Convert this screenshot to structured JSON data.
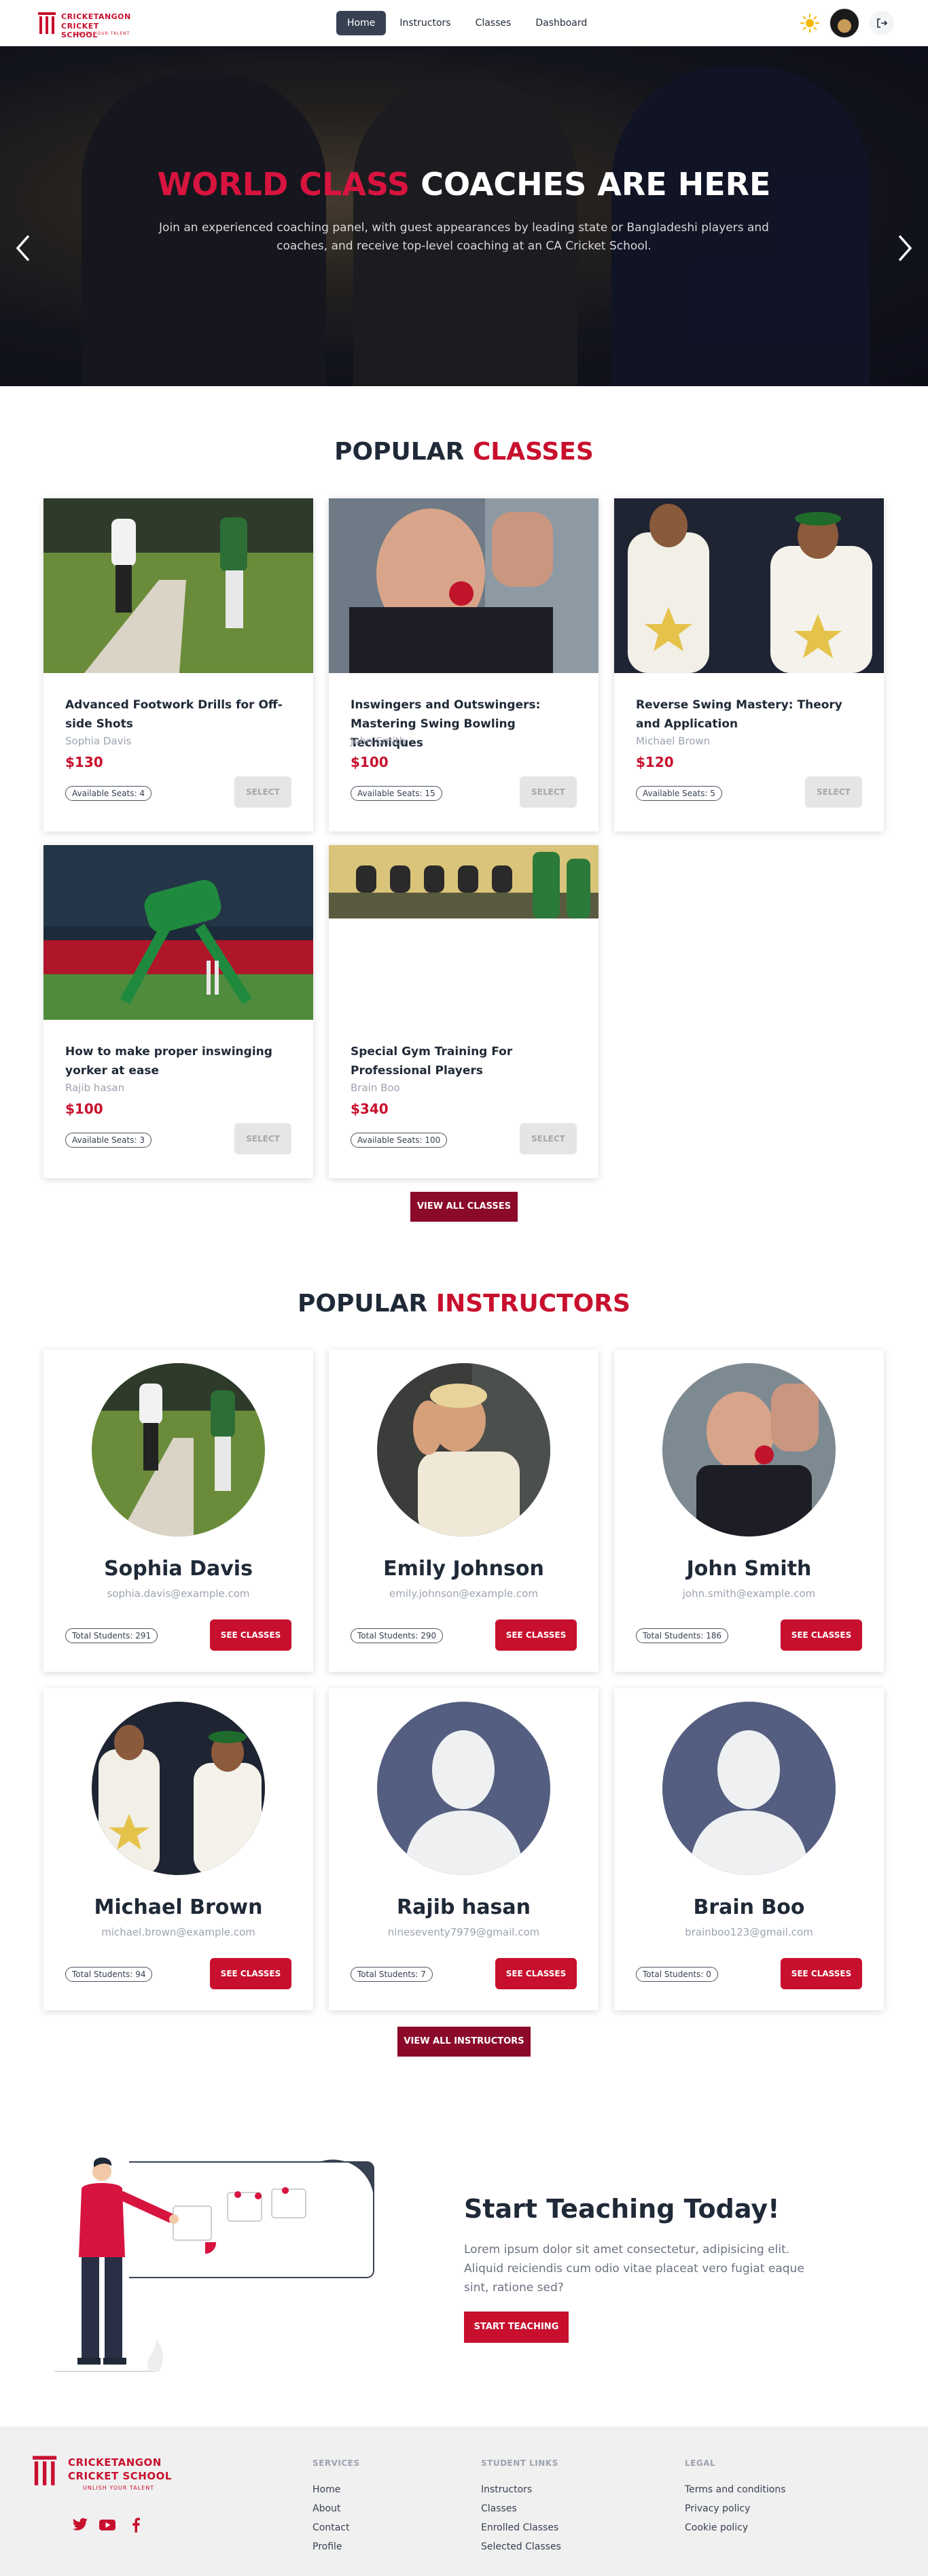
{
  "brand": {
    "line1": "CRICKETANGON",
    "line2": "CRICKET SCHOOL",
    "tagline": "UNLISH YOUR TALENT",
    "accent_color": "#c8102e"
  },
  "nav": {
    "links": [
      "Home",
      "Instructors",
      "Classes",
      "Dashboard"
    ],
    "active": "Home",
    "theme_icon": "sun-icon",
    "logout_icon": "logout-icon"
  },
  "hero": {
    "title_accent": "WORLD CLASS",
    "title_rest": "COACHES ARE HERE",
    "subtitle": "Join an experienced coaching panel, with guest appearances by leading state or Bangladeshi players and coaches, and receive top-level coaching at an CA Cricket School.",
    "prev_icon": "chevron-left-icon",
    "next_icon": "chevron-right-icon"
  },
  "classes_section": {
    "title_plain": "POPULAR",
    "title_accent": "CLASSES",
    "seats_prefix": "Available Seats: ",
    "select_label": "SELECT",
    "items": [
      {
        "title": "Advanced Footwork Drills for Off-side Shots",
        "instructor": "Sophia Davis",
        "price": "$130",
        "seats": 4
      },
      {
        "title": "Inswingers and Outswingers: Mastering Swing Bowling Techniques",
        "instructor": "John Smith",
        "price": "$100",
        "seats": 15
      },
      {
        "title": "Reverse Swing Mastery: Theory and Application",
        "instructor": "Michael Brown",
        "price": "$120",
        "seats": 5
      },
      {
        "title": "How to make proper inswinging yorker at ease",
        "instructor": "Rajib hasan",
        "price": "$100",
        "seats": 3
      },
      {
        "title": "Special Gym Training For Professional Players",
        "instructor": "Brain Boo",
        "price": "$340",
        "seats": 100
      }
    ],
    "view_all": "VIEW ALL CLASSES"
  },
  "instructors_section": {
    "title_plain": "POPULAR",
    "title_accent": "INSTRUCTORS",
    "students_prefix": "Total Students: ",
    "see_label": "SEE CLASSES",
    "items": [
      {
        "name": "Sophia Davis",
        "email": "sophia.davis@example.com",
        "students": 291
      },
      {
        "name": "Emily Johnson",
        "email": "emily.johnson@example.com",
        "students": 290
      },
      {
        "name": "John Smith",
        "email": "john.smith@example.com",
        "students": 186
      },
      {
        "name": "Michael Brown",
        "email": "michael.brown@example.com",
        "students": 94
      },
      {
        "name": "Rajib hasan",
        "email": "nineseventy7979@gmail.com",
        "students": 7
      },
      {
        "name": "Brain Boo",
        "email": "brainboo123@gmail.com",
        "students": 0
      }
    ],
    "view_all": "VIEW ALL INSTRUCTORS"
  },
  "teaching": {
    "title": "Start Teaching Today!",
    "text": "Lorem ipsum dolor sit amet consectetur, adipisicing elit. Aliquid reiciendis cum odio vitae placeat vero fugiat eaque sint, ratione sed?",
    "button": "START TEACHING"
  },
  "footer": {
    "services": {
      "heading": "SERVICES",
      "links": [
        "Home",
        "About",
        "Contact",
        "Profile"
      ]
    },
    "student_links": {
      "heading": "STUDENT LINKS",
      "links": [
        "Instructors",
        "Classes",
        "Enrolled Classes",
        "Selected Classes"
      ]
    },
    "legal": {
      "heading": "LEGAL",
      "links": [
        "Terms and conditions",
        "Privacy policy",
        "Cookie policy"
      ]
    },
    "social_icons": [
      "twitter-icon",
      "youtube-icon",
      "facebook-icon"
    ]
  }
}
